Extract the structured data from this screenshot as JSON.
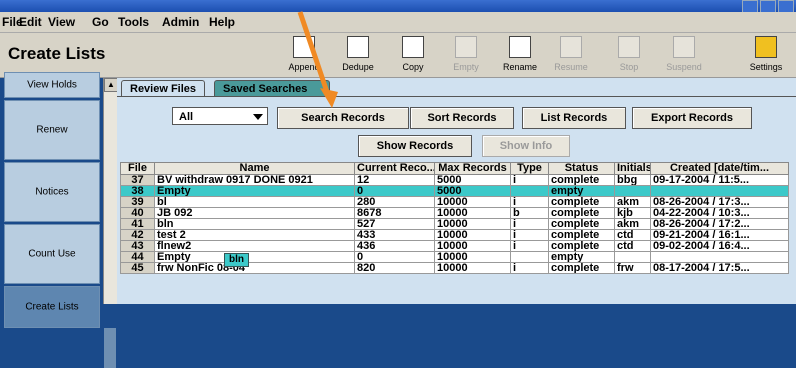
{
  "menu": [
    "File",
    "Edit",
    "View",
    "Go",
    "Tools",
    "Admin",
    "Help"
  ],
  "app_title": "Create Lists",
  "toolbar": [
    {
      "label": "Append",
      "icon": "append-icon",
      "enabled": true
    },
    {
      "label": "Dedupe",
      "icon": "dedupe-icon",
      "enabled": true
    },
    {
      "label": "Copy",
      "icon": "copy-icon",
      "enabled": true
    },
    {
      "label": "Empty",
      "icon": "empty-icon",
      "enabled": false
    },
    {
      "label": "Rename",
      "icon": "rename-icon",
      "enabled": true
    },
    {
      "label": "Resume",
      "icon": "resume-icon",
      "enabled": false
    },
    {
      "label": "Stop",
      "icon": "stop-icon",
      "enabled": false
    },
    {
      "label": "Suspend",
      "icon": "suspend-icon",
      "enabled": false
    },
    {
      "label": "Settings",
      "icon": "settings-icon",
      "enabled": true
    }
  ],
  "sidebar": [
    "View Holds",
    "Renew",
    "Notices",
    "Count Use",
    "Create Lists"
  ],
  "tabs": {
    "review": "Review Files",
    "saved": "Saved Searches"
  },
  "filter": {
    "value": "All"
  },
  "buttons": {
    "search": "Search Records",
    "sort": "Sort Records",
    "list": "List Records",
    "export": "Export Records",
    "show_records": "Show Records",
    "show_info": "Show Info"
  },
  "table": {
    "columns": [
      "File",
      "Name",
      "Current Reco...",
      "Max Records",
      "Type",
      "Status",
      "Initials",
      "Created [date/tim..."
    ],
    "rows": [
      [
        "37",
        "BV withdraw 0917 DONE 0921",
        "12",
        "5000",
        "i",
        "complete",
        "bbg",
        "09-17-2004 / 11:5..."
      ],
      [
        "38",
        "Empty",
        "0",
        "5000",
        "",
        "empty",
        "",
        ""
      ],
      [
        "39",
        "bl",
        "280",
        "10000",
        "i",
        "complete",
        "akm",
        "08-26-2004 / 17:3..."
      ],
      [
        "40",
        "JB 092",
        "8678",
        "10000",
        "b",
        "complete",
        "kjb",
        "04-22-2004 / 10:3..."
      ],
      [
        "41",
        "bln",
        "527",
        "10000",
        "i",
        "complete",
        "akm",
        "08-26-2004 / 17:2..."
      ],
      [
        "42",
        "test 2",
        "433",
        "10000",
        "i",
        "complete",
        "ctd",
        "09-21-2004 / 16:1..."
      ],
      [
        "43",
        "flnew2",
        "436",
        "10000",
        "i",
        "complete",
        "ctd",
        "09-02-2004 / 16:4..."
      ],
      [
        "44",
        "Empty",
        "0",
        "10000",
        "",
        "empty",
        "",
        ""
      ],
      [
        "45",
        "frw NonFic 08-04",
        "820",
        "10000",
        "i",
        "complete",
        "frw",
        "08-17-2004 / 17:5..."
      ]
    ],
    "selected_row": 1
  },
  "tooltip": "bln",
  "colors": {
    "selection": "#3cc9c9",
    "background": "#1a4a8a",
    "panel": "#d0e1f0",
    "pointer": "#f08a24"
  }
}
